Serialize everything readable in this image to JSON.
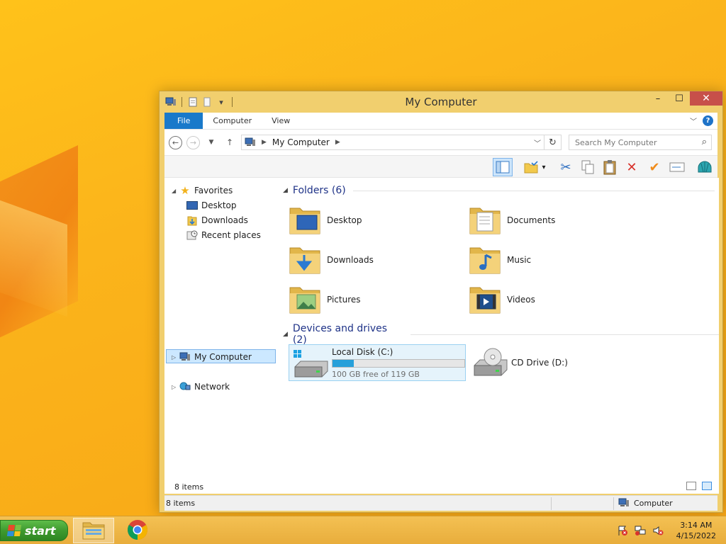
{
  "window": {
    "title": "My Computer"
  },
  "ribbon": {
    "tabs": [
      "File",
      "Computer",
      "View"
    ]
  },
  "navbar": {
    "breadcrumb": "My Computer",
    "search_placeholder": "Search My Computer"
  },
  "nav_pane": {
    "favorites": "Favorites",
    "favorite_items": [
      "Desktop",
      "Downloads",
      "Recent places"
    ],
    "computer": "My Computer",
    "network": "Network"
  },
  "content": {
    "folders_header": "Folders (6)",
    "folders": [
      {
        "label": "Desktop",
        "icon": "desktop-folder-icon"
      },
      {
        "label": "Documents",
        "icon": "documents-folder-icon"
      },
      {
        "label": "Downloads",
        "icon": "downloads-folder-icon"
      },
      {
        "label": "Music",
        "icon": "music-folder-icon"
      },
      {
        "label": "Pictures",
        "icon": "pictures-folder-icon"
      },
      {
        "label": "Videos",
        "icon": "videos-folder-icon"
      }
    ],
    "drives_header": "Devices and drives (2)",
    "drives": [
      {
        "label": "Local Disk (C:)",
        "free_text": "100 GB free of 119 GB",
        "used_fraction": 0.16,
        "icon": "hard-drive-icon"
      },
      {
        "label": "CD Drive (D:)",
        "icon": "cd-drive-icon"
      }
    ]
  },
  "inner_status": {
    "items": "8 items"
  },
  "status_bar": {
    "items": "8 items",
    "location": "Computer"
  },
  "taskbar": {
    "start_label": "start",
    "time": "3:14 AM",
    "date": "4/15/2022"
  },
  "colors": {
    "desktop": "#fbb41b",
    "window_frame": "#f1cf6e",
    "file_tab": "#1979ca",
    "close_button": "#c7504a",
    "progress": "#26a0da",
    "start_button": "#3f9a2f"
  }
}
